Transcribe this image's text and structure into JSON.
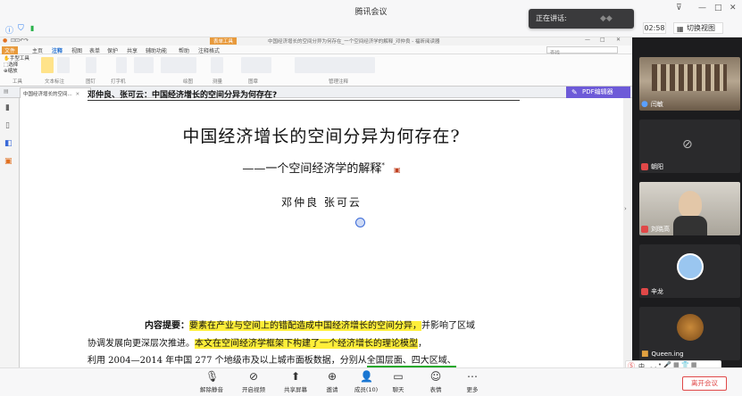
{
  "app": {
    "title": "腾讯会议",
    "speaking_label": "正在讲话:",
    "timer": "02:58",
    "view_switch": "切换视图"
  },
  "pdf": {
    "window_title": "中国经济增长的空间分异为何存在_一个空间经济学的解释_邓仲良 - 福昕阅读器",
    "ribbon_context_tab": "表单工具",
    "tabs": [
      "文件",
      "主页",
      "注释",
      "视图",
      "表单",
      "保护",
      "共享",
      "辅助功能",
      "帮助",
      "注释格式"
    ],
    "groups": [
      "工具",
      "文本标注",
      "图钉",
      "打字机",
      "绘图",
      "测量",
      "图章",
      "管理注释"
    ],
    "tools": {
      "hand": "手型工具",
      "select": "选择",
      "zoom": "缩放",
      "highlight": "高亮",
      "underline": "下划线",
      "strikeout": "删除线",
      "squiggly": "波浪线"
    },
    "search_placeholder": "查找",
    "doc_tab": "中国经济增长的空间...",
    "editor_button": "PDF编辑器"
  },
  "document": {
    "running_head": "邓仲良、张可云：中国经济增长的空间分异为何存在?",
    "title": "中国经济增长的空间分异为何存在?",
    "subtitle": "——一个空间经济学的解释",
    "subtitle_mark": "*",
    "authors": "邓仲良    张可云",
    "abstract_label": "内容提要：",
    "line1_hl": "要素在产业与空间上的错配造成中国经济增长的空间分异，",
    "line1_rest": "并影响了区域",
    "line2_pre": "协调发展向更深层次推进。",
    "line2_hl": "本文在空间经济学框架下构建了一个经济增长的理论模型",
    "line2_post": "，",
    "line3_pre": "利用 2004—2014 年中国 277 个地级市及以上城市面板数据，分别从",
    "line3_ul": "全国层面、四大区域、"
  },
  "participants": [
    {
      "name": "闫敏"
    },
    {
      "name": "朝阳"
    },
    {
      "name": "刘晓高"
    },
    {
      "name": "辛龙"
    },
    {
      "name": "Queen.ing"
    }
  ],
  "toolbar": {
    "mute": "解除静音",
    "video": "开启视频",
    "share": "共享屏幕",
    "invite": "邀请",
    "members": "成员(10)",
    "chat": "聊天",
    "reactions": "表情",
    "more": "更多",
    "leave": "离开会议"
  },
  "floatbar": {
    "lang": "中"
  },
  "colors": {
    "highlight": "#ffef3a",
    "underline": "#1fa82a",
    "leave": "#e04848",
    "editor": "#6d5ad8"
  }
}
